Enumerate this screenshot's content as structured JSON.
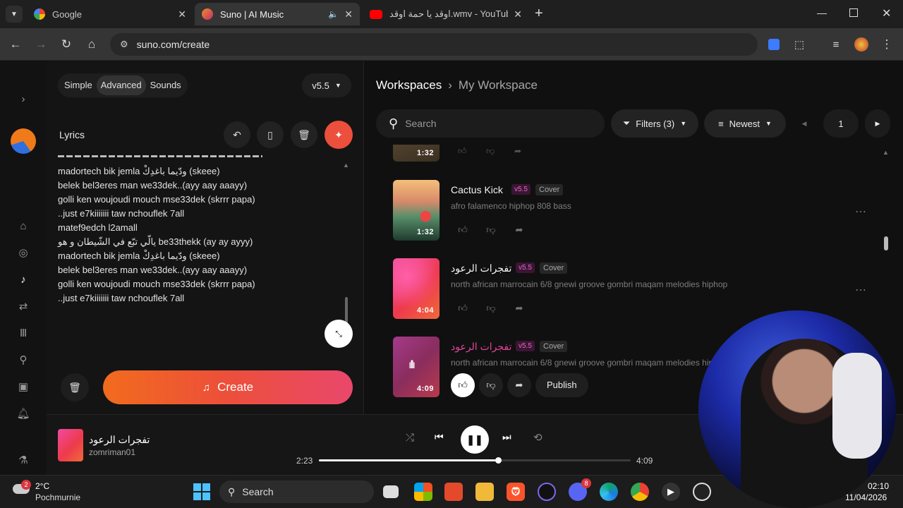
{
  "browser": {
    "tabs": [
      {
        "title": "Google",
        "favicon": "google-icon",
        "active": false
      },
      {
        "title": "Suno | AI Music",
        "favicon": "suno-icon",
        "active": true
      },
      {
        "title": "اوقد يا حمة اوقد.wmv - YouTube",
        "favicon": "youtube-icon",
        "active": false
      }
    ],
    "url": "suno.com/create"
  },
  "left": {
    "modes": [
      "Simple",
      "Advanced",
      "Sounds"
    ],
    "active_mode": "Advanced",
    "version": "v5.5",
    "lyrics_label": "Lyrics",
    "lyrics_lines": [
      "madortech bik jemla ودّيما باغدِكْ (skeee)",
      "belek bel3eres man we33dek..(ayy aay aaayy)",
      "golli ken woujoudi mouch mse33dek (skrrr papa)",
      "..just e7kiiiiiii  taw nchouflek 7all",
      "matef9edch l2amall",
      "يالّي تبّع في الشّيطان و هو be33thekk (ay ay ayyy)",
      "madortech bik jemla ودّيما باغدِكْ (skeee)",
      "belek bel3eres man we33dek..(ayy aay aaayy)",
      "golli ken woujoudi mouch mse33dek (skrrr papa)",
      "..just e7kiiiiiii  taw nchouflek 7all"
    ],
    "create_label": "Create"
  },
  "right": {
    "breadcrumb_root": "Workspaces",
    "breadcrumb_current": "My Workspace",
    "search_placeholder": "Search",
    "filters_label": "Filters (3)",
    "sort_label": "Newest",
    "page": "1",
    "partial_duration": "1:32",
    "songs": [
      {
        "title": "Cactus Kick",
        "version": "v5.5",
        "tag": "Cover",
        "desc": "afro falamenco hiphop 808 bass",
        "duration": "1:32",
        "playing": false
      },
      {
        "title": "تفجرات الرعود",
        "version": "v5.5",
        "tag": "Cover",
        "desc": "north african marrocain 6/8 gnewi groove gombri maqam melodies hiphop",
        "duration": "4:04",
        "playing": false
      },
      {
        "title": "تفجرات الرعود",
        "version": "v5.5",
        "tag": "Cover",
        "desc": "north african marrocain 6/8 gnewi groove gombri maqam melodies hiphop",
        "duration": "4:09",
        "playing": true
      }
    ],
    "publish_label": "Publish"
  },
  "player": {
    "title": "تفجرات الرعود",
    "artist": "zomriman01",
    "elapsed": "2:23",
    "total": "4:09",
    "progress": 0.574
  },
  "taskbar": {
    "weather_temp": "2°C",
    "weather_desc": "Pochmurnie",
    "weather_badge": "2",
    "search_label": "Search",
    "time": "02:10",
    "date": "11/04/2026",
    "discord_badge": "8"
  },
  "colors": {
    "accent": "#ec4f3b",
    "pink_title": "#e0449a",
    "background": "#0d0d0d"
  }
}
